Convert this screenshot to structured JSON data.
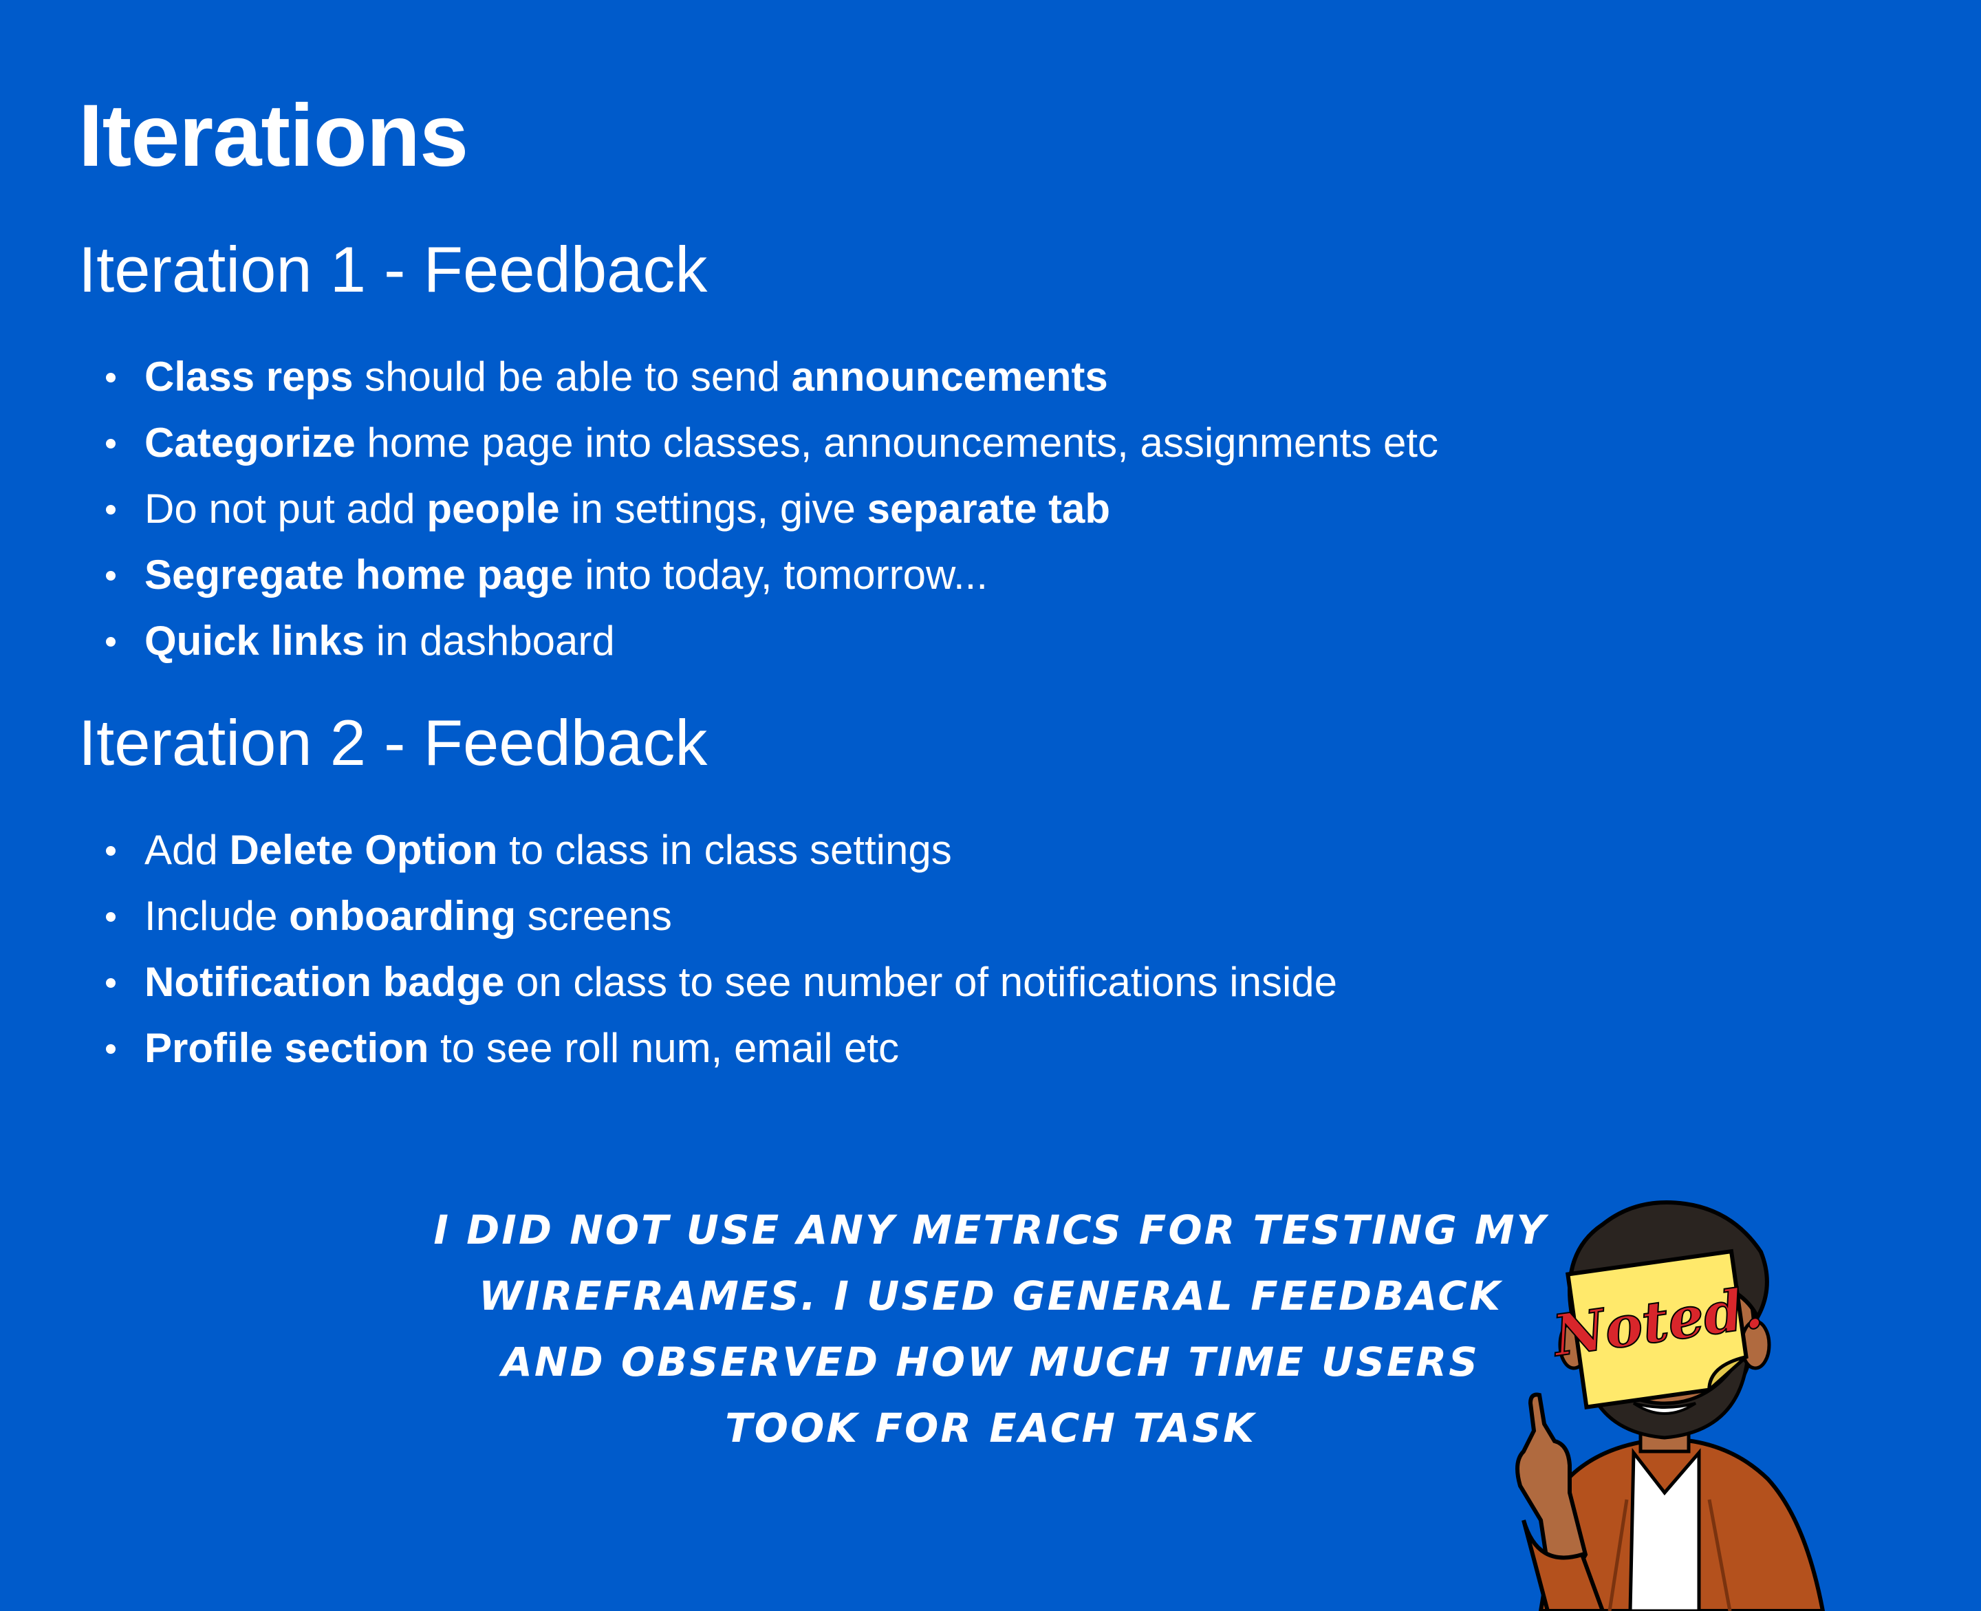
{
  "title": "Iterations",
  "sections": [
    {
      "title": "Iteration 1 - Feedback",
      "items": [
        {
          "b1": "Class reps",
          "t1": " should be able to send ",
          "b2": "announcements",
          "t2": ""
        },
        {
          "b1": "Categorize",
          "t1": " home page into classes, announcements, assignments etc",
          "b2": "",
          "t2": ""
        },
        {
          "p0": "Do not put add ",
          "b1": "people",
          "t1": " in settings, give ",
          "b2": "separate tab",
          "t2": ""
        },
        {
          "b1": "Segregate home page",
          "t1": " into today, tomorrow...",
          "b2": "",
          "t2": ""
        },
        {
          "b1": "Quick links",
          "t1": " in dashboard",
          "b2": "",
          "t2": ""
        }
      ]
    },
    {
      "title": "Iteration 2 - Feedback",
      "items": [
        {
          "p0": "Add ",
          "b1": "Delete Option",
          "t1": " to class in class settings"
        },
        {
          "p0": "Include ",
          "b1": "onboarding",
          "t1": " screens"
        },
        {
          "b1": "Notification badge",
          "t1": " on class to see number of notifications inside"
        },
        {
          "b1": "Profile section",
          "t1": " to see roll num, email etc"
        }
      ]
    }
  ],
  "note": "I did not use any metrics for testing my wireframes. I used general feedback and observed how much time users took for each task",
  "sticker_text": "Noted.",
  "colors": {
    "background": "#005bcb",
    "text": "#ffffff",
    "sticky_note": "#ffe96b",
    "sticker_text": "#d8262b",
    "jacket": "#b4511d"
  }
}
